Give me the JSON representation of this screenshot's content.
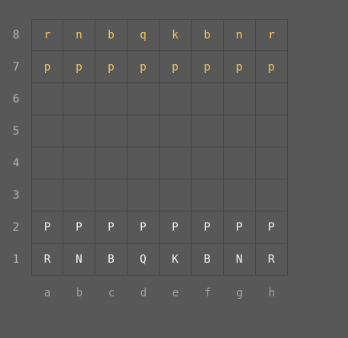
{
  "colors": {
    "background": "#585858",
    "grid_line": "#444444",
    "black_piece": "#f2c46a",
    "white_piece": "#f0f0f0",
    "rank_label": "#b4b4b4",
    "file_label": "#a0a0a0"
  },
  "ranks": [
    "8",
    "7",
    "6",
    "5",
    "4",
    "3",
    "2",
    "1"
  ],
  "files": [
    "a",
    "b",
    "c",
    "d",
    "e",
    "f",
    "g",
    "h"
  ],
  "board": [
    [
      "r",
      "n",
      "b",
      "q",
      "k",
      "b",
      "n",
      "r"
    ],
    [
      "p",
      "p",
      "p",
      "p",
      "p",
      "p",
      "p",
      "p"
    ],
    [
      "",
      "",
      "",
      "",
      "",
      "",
      "",
      ""
    ],
    [
      "",
      "",
      "",
      "",
      "",
      "",
      "",
      ""
    ],
    [
      "",
      "",
      "",
      "",
      "",
      "",
      "",
      ""
    ],
    [
      "",
      "",
      "",
      "",
      "",
      "",
      "",
      ""
    ],
    [
      "P",
      "P",
      "P",
      "P",
      "P",
      "P",
      "P",
      "P"
    ],
    [
      "R",
      "N",
      "B",
      "Q",
      "K",
      "B",
      "N",
      "R"
    ]
  ]
}
